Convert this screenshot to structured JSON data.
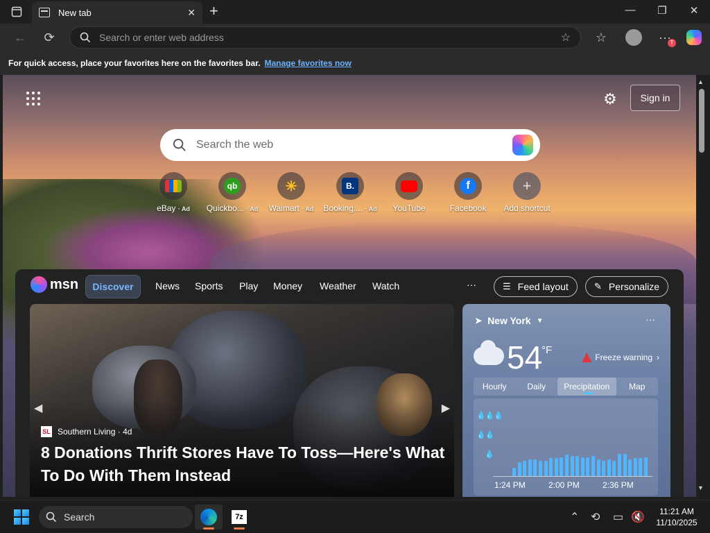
{
  "browser": {
    "tab_title": "New tab",
    "address_placeholder": "Search or enter web address",
    "favorites_bar_text": "For quick access, place your favorites here on the favorites bar.",
    "favorites_bar_link": "Manage favorites now",
    "profile_badge": "T"
  },
  "newtab": {
    "sign_in": "Sign in",
    "search_placeholder": "Search the web",
    "shortcuts": [
      {
        "label": "eBay",
        "ad": "· Ad",
        "icon": "ebay-icon",
        "color": "#3a3a3a"
      },
      {
        "label": "Quickbo...",
        "ad": "· Ad",
        "icon": "quickbooks-icon",
        "color": "#2ca01c"
      },
      {
        "label": "Walmart",
        "ad": "· Ad",
        "icon": "walmart-icon",
        "color": "#0071ce"
      },
      {
        "label": "Booking....",
        "ad": "· Ad",
        "icon": "booking-icon",
        "color": "#003580"
      },
      {
        "label": "YouTube",
        "ad": "",
        "icon": "youtube-icon",
        "color": "#ff0000"
      },
      {
        "label": "Facebook",
        "ad": "",
        "icon": "facebook-icon",
        "color": "#1877f2"
      },
      {
        "label": "Add shortcut",
        "ad": "",
        "icon": "plus-icon",
        "color": "#6b6b6b"
      }
    ]
  },
  "feed": {
    "brand": "msn",
    "nav": [
      "Discover",
      "News",
      "Sports",
      "Play",
      "Money",
      "Weather",
      "Watch"
    ],
    "more": "···",
    "feed_layout": "Feed layout",
    "personalize": "Personalize",
    "hero": {
      "source": "Southern Living",
      "source_logo": "SL",
      "age": "· 4d",
      "headline": "8 Donations Thrift Stores Have To Toss—Here's What To Do With Them Instead"
    },
    "weather": {
      "location": "New York",
      "temp": "54",
      "unit": "°F",
      "warning": "Freeze warning",
      "tabs": [
        "Hourly",
        "Daily",
        "Precipitation",
        "Map"
      ],
      "active_tab": "Precipitation",
      "chart_labels": [
        "1:24 PM",
        "2:00 PM",
        "2:36 PM"
      ],
      "precip_levels": [
        0.35,
        0.6,
        0.65,
        0.7,
        0.7,
        0.65,
        0.65,
        0.75,
        0.75,
        0.8,
        0.9,
        0.85,
        0.85,
        0.8,
        0.8,
        0.85,
        0.7,
        0.65,
        0.7,
        0.65,
        0.95,
        0.95,
        0.7,
        0.75,
        0.75,
        0.8
      ]
    }
  },
  "taskbar": {
    "search": "Search",
    "time": "11:21 AM",
    "date": "11/10/2025",
    "app_7z": "7z"
  }
}
